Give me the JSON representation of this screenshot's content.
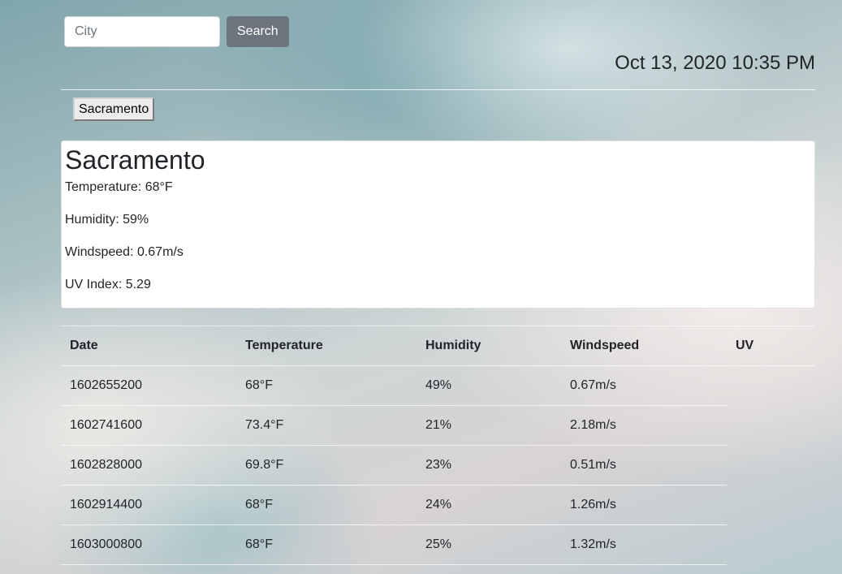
{
  "search": {
    "placeholder": "City",
    "button_label": "Search"
  },
  "datetime": "Oct 13, 2020 10:35 PM",
  "history": [
    "Sacramento"
  ],
  "current": {
    "city": "Sacramento",
    "temperature": "Temperature: 68°F",
    "humidity": "Humidity: 59%",
    "windspeed": "Windspeed: 0.67m/s",
    "uv_index": "UV Index: 5.29"
  },
  "forecast": {
    "headers": [
      "Date",
      "Temperature",
      "Humidity",
      "Windspeed",
      "UV"
    ],
    "rows": [
      [
        "1602655200",
        "68°F",
        "49%",
        "0.67m/s",
        ""
      ],
      [
        "1602741600",
        "73.4°F",
        "21%",
        "2.18m/s",
        ""
      ],
      [
        "1602828000",
        "69.8°F",
        "23%",
        "0.51m/s",
        ""
      ],
      [
        "1602914400",
        "68°F",
        "24%",
        "1.26m/s",
        ""
      ],
      [
        "1603000800",
        "68°F",
        "25%",
        "1.32m/s",
        ""
      ]
    ]
  }
}
